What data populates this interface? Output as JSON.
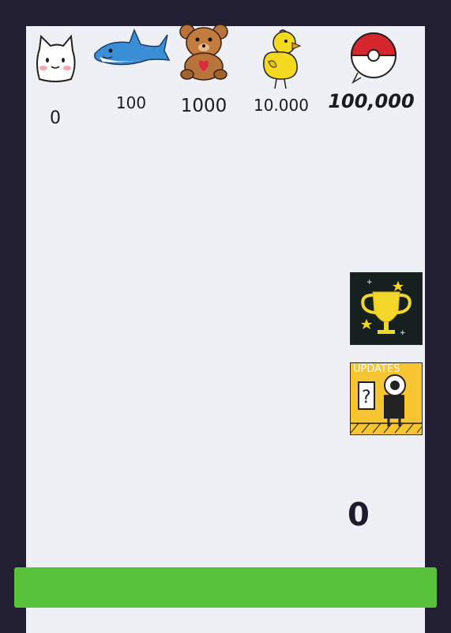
{
  "milestones": [
    {
      "icon": "cat-icon",
      "label": "0"
    },
    {
      "icon": "shark-icon",
      "label": "100"
    },
    {
      "icon": "teddy-bear-icon",
      "label": "1000"
    },
    {
      "icon": "chick-icon",
      "label": "10.000"
    },
    {
      "icon": "pokeball-icon",
      "label": "100,000"
    }
  ],
  "buttons": {
    "achievements_icon": "trophy-icon",
    "updates_label": "UPDATES"
  },
  "score": "0",
  "colors": {
    "background": "#221f33",
    "panel": "#efeff6",
    "action_button": "#57c23a",
    "trophy_tile": "#16211f",
    "updates_tile": "#f7c531"
  }
}
